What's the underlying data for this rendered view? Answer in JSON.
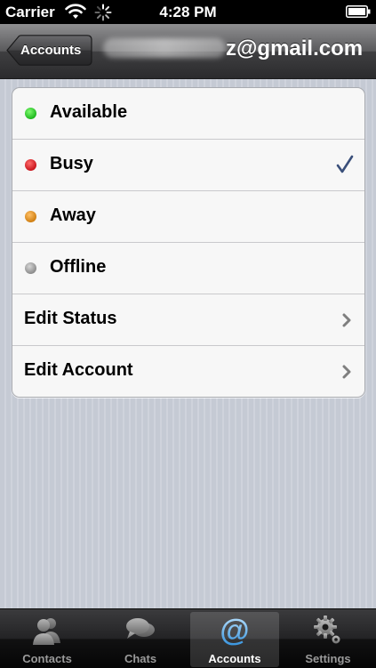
{
  "status_bar": {
    "carrier": "Carrier",
    "time": "4:28 PM"
  },
  "nav_bar": {
    "back_label": "Accounts",
    "title_visible_suffix": "z@gmail.com"
  },
  "status_list": [
    {
      "label": "Available",
      "dot_color": "#2ecc2e",
      "selected": false
    },
    {
      "label": "Busy",
      "dot_color": "#d91f26",
      "selected": true
    },
    {
      "label": "Away",
      "dot_color": "#e08b1c",
      "selected": false
    },
    {
      "label": "Offline",
      "dot_color": "#9a9a9a",
      "selected": false
    }
  ],
  "actions": [
    {
      "label": "Edit Status"
    },
    {
      "label": "Edit Account"
    }
  ],
  "tab_bar": {
    "tabs": [
      {
        "label": "Contacts",
        "icon": "contacts-icon",
        "selected": false
      },
      {
        "label": "Chats",
        "icon": "chats-icon",
        "selected": false
      },
      {
        "label": "Accounts",
        "icon": "at-sign-icon",
        "selected": true
      },
      {
        "label": "Settings",
        "icon": "gear-icon",
        "selected": false
      }
    ]
  },
  "colors": {
    "checkmark": "#3a4f7a",
    "chevron": "#7f7f7f",
    "accent_selected_tab": "#5aa9e8"
  }
}
